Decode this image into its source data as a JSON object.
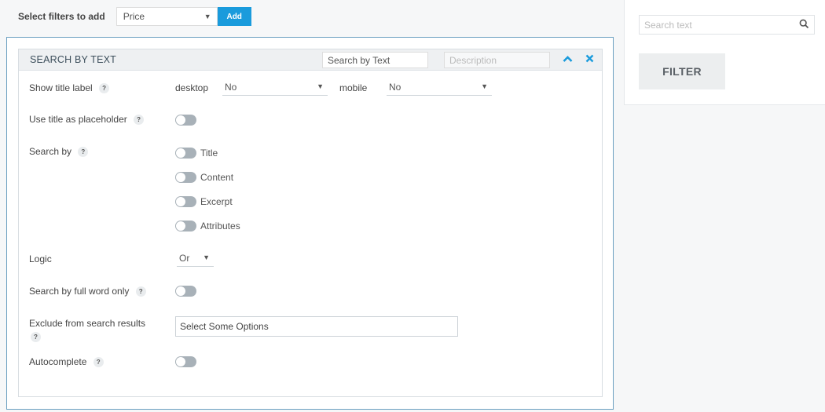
{
  "top": {
    "label": "Select filters to add",
    "select_value": "Price",
    "add_label": "Add"
  },
  "filter": {
    "title": "SEARCH BY TEXT",
    "title_input": "Search by Text",
    "description_placeholder": "Description",
    "show_title_label": "Show title label",
    "desktop_label": "desktop",
    "desktop_value": "No",
    "mobile_label": "mobile",
    "mobile_value": "No",
    "use_title_placeholder": "Use title as placeholder",
    "search_by": "Search by",
    "search_by_options": [
      "Title",
      "Content",
      "Excerpt",
      "Attributes"
    ],
    "logic_label": "Logic",
    "logic_value": "Or",
    "full_word": "Search by full word only",
    "exclude_label": "Exclude from search results",
    "exclude_value": "Select Some Options",
    "autocomplete": "Autocomplete",
    "help_glyph": "?"
  },
  "preview": {
    "search_placeholder": "Search text",
    "filter_label": "FILTER"
  },
  "colors": {
    "accent": "#1a9bdc",
    "toggle_off": "#a8b1b8",
    "panel_border": "#6a9fc0"
  },
  "icons": {
    "dropdown": "chevron-down-icon",
    "collapse": "chevron-up-icon",
    "close": "close-icon",
    "search": "search-icon",
    "help": "help-icon"
  }
}
